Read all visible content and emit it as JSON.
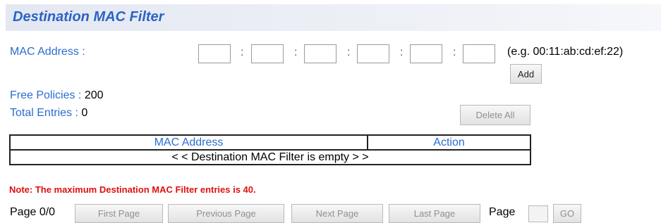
{
  "title": "Destination MAC Filter",
  "mac": {
    "label": "MAC Address :",
    "octets": [
      "",
      "",
      "",
      "",
      "",
      ""
    ],
    "separator": ":",
    "example": "(e.g. 00:11:ab:cd:ef:22)",
    "add_label": "Add"
  },
  "free_policies": {
    "label": "Free Policies :",
    "value": "200"
  },
  "total_entries": {
    "label": "Total Entries :",
    "value": "0"
  },
  "delete_all_label": "Delete All",
  "table": {
    "headers": [
      "MAC Address",
      "Action"
    ],
    "empty_message": "< < Destination MAC Filter is empty > >"
  },
  "note": "Note: The maximum Destination MAC Filter entries is 40.",
  "pager": {
    "page_status": "Page 0/0",
    "first_label": "First Page",
    "previous_label": "Previous Page",
    "next_label": "Next Page",
    "last_label": "Last Page",
    "page_label": "Page",
    "page_input": "",
    "go_label": "GO"
  },
  "colors": {
    "title": "#2b63c4",
    "label": "#2b6dd0",
    "note": "#e01010"
  }
}
